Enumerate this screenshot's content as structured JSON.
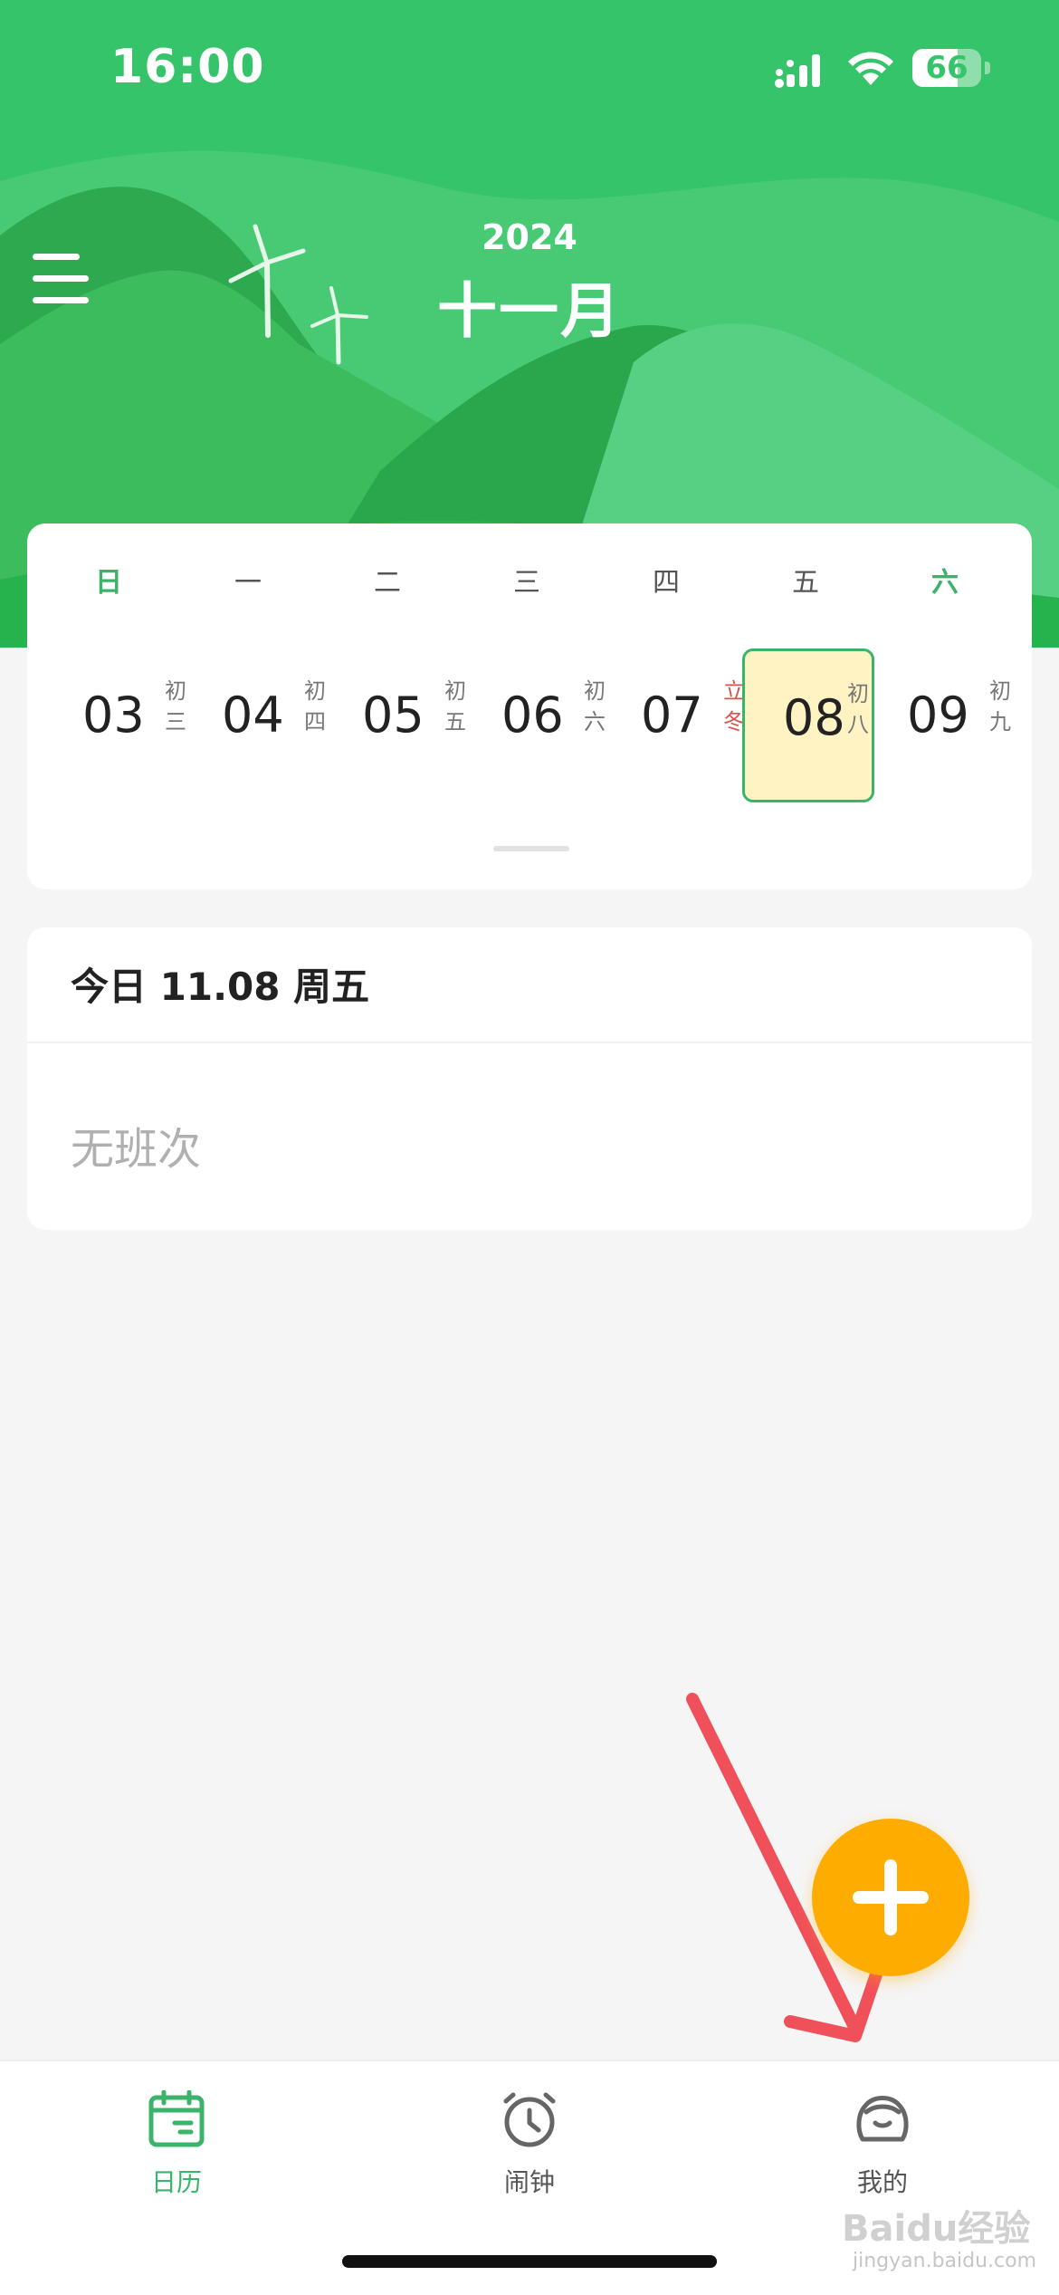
{
  "status_bar": {
    "time": "16:00",
    "battery": "66",
    "battery_level": 0.66
  },
  "header": {
    "year": "2024",
    "month": "十一月"
  },
  "week_header": [
    "日",
    "一",
    "二",
    "三",
    "四",
    "五",
    "六"
  ],
  "days": [
    {
      "num": "03",
      "lunar1": "初",
      "lunar2": "三"
    },
    {
      "num": "04",
      "lunar1": "初",
      "lunar2": "四"
    },
    {
      "num": "05",
      "lunar1": "初",
      "lunar2": "五"
    },
    {
      "num": "06",
      "lunar1": "初",
      "lunar2": "六"
    },
    {
      "num": "07",
      "lunar1": "立",
      "lunar2": "冬"
    },
    {
      "num": "08",
      "lunar1": "初",
      "lunar2": "八"
    },
    {
      "num": "09",
      "lunar1": "初",
      "lunar2": "九"
    }
  ],
  "today": {
    "title": "今日 11.08 周五",
    "shift": "无班次"
  },
  "tabs": [
    {
      "label": "日历",
      "icon": "calendar-icon"
    },
    {
      "label": "闹钟",
      "icon": "alarm-clock-icon"
    },
    {
      "label": "我的",
      "icon": "profile-icon"
    }
  ],
  "watermark": {
    "logo": "Baidu经验",
    "url": "jingyan.baidu.com"
  },
  "colors": {
    "primary_green": "#35c469",
    "accent_green": "#3cb36a",
    "fab_orange": "#ffac00",
    "selected_day_bg": "#fff3c4",
    "solar_term_red": "#d9534f",
    "annotation_arrow": "#f0505a"
  }
}
